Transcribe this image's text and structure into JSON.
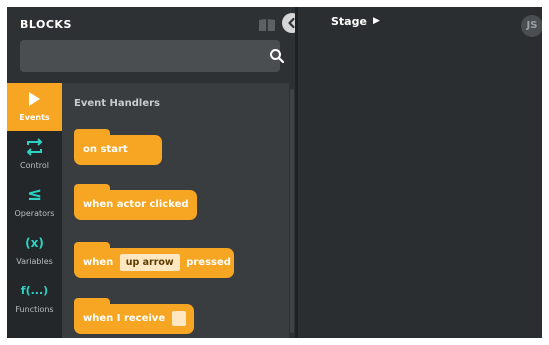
{
  "header": {
    "title": "BLOCKS",
    "book_icon": "book-icon",
    "collapse_icon": "chevron-left-icon"
  },
  "search": {
    "placeholder": "",
    "value": "",
    "icon": "search-icon"
  },
  "categories": [
    {
      "label": "Events",
      "icon": "play-icon",
      "color": "#ffffff",
      "active": true
    },
    {
      "label": "Control",
      "icon": "loop-icon",
      "color": "#2bd4c4",
      "active": false
    },
    {
      "label": "Operators",
      "icon": "less-equal-icon",
      "color": "#2bd4c4",
      "active": false
    },
    {
      "label": "Variables",
      "icon": "variable-icon",
      "color": "#2bd4c4",
      "active": false
    },
    {
      "label": "Functions",
      "icon": "function-icon",
      "color": "#2bd4c4",
      "active": false
    }
  ],
  "icons_text": {
    "operators": "≤",
    "variables": "(x)",
    "functions": "f(...)"
  },
  "palette": {
    "section_title": "Event Handlers",
    "blocks": [
      {
        "text": "on start"
      },
      {
        "text": "when actor clicked"
      },
      {
        "prefix": "when",
        "field": "up arrow",
        "suffix": "pressed"
      },
      {
        "prefix": "when I receive"
      }
    ]
  },
  "stage": {
    "title": "Stage"
  },
  "user": {
    "initials": "JS"
  },
  "colors": {
    "accent": "#f6a623",
    "panel": "#2d3134",
    "palette_bg": "#393d40",
    "category_bg": "#23272a"
  }
}
